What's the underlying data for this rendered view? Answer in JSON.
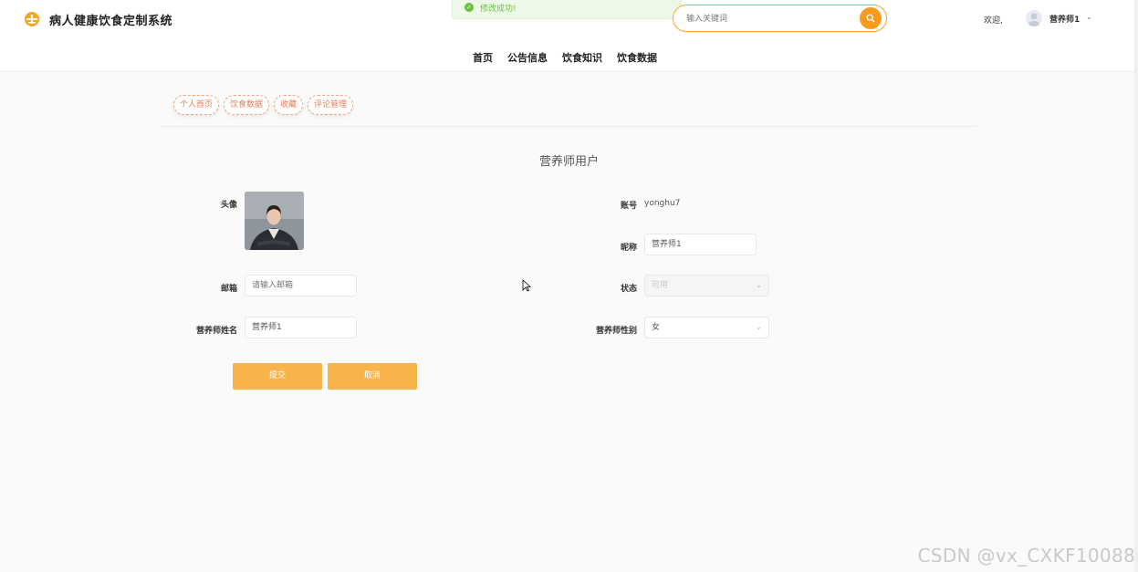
{
  "app": {
    "title": "病人健康饮食定制系统",
    "accent_color": "#f79a1e",
    "icon": "logo-icon"
  },
  "toast": {
    "message": "修改成功!",
    "color": "#67c23a",
    "icon": "check-circle-icon"
  },
  "search": {
    "placeholder": "输入关键词",
    "icon": "search-icon"
  },
  "user_menu": {
    "welcome": "欢迎,",
    "username": "营养师1",
    "icon": "chevron-down-icon"
  },
  "nav": {
    "items": [
      "首页",
      "公告信息",
      "饮食知识",
      "饮食数据"
    ]
  },
  "subtabs": [
    "个人首页",
    "饮食数据",
    "收藏",
    "评论管理"
  ],
  "form": {
    "title": "营养师用户",
    "avatar_label": "头像",
    "account_label": "账号",
    "account_value": "yonghu7",
    "nickname_label": "昵称",
    "nickname_value": "营养师1",
    "email_label": "邮箱",
    "email_placeholder": "请输入邮箱",
    "status_label": "状态",
    "status_value": "可用",
    "name_label": "营养师姓名",
    "name_value": "营养师1",
    "gender_label": "营养师性别",
    "gender_value": "女"
  },
  "buttons": {
    "submit": "提交",
    "cancel": "取消"
  },
  "watermark": "CSDN @vx_CXKF10088"
}
